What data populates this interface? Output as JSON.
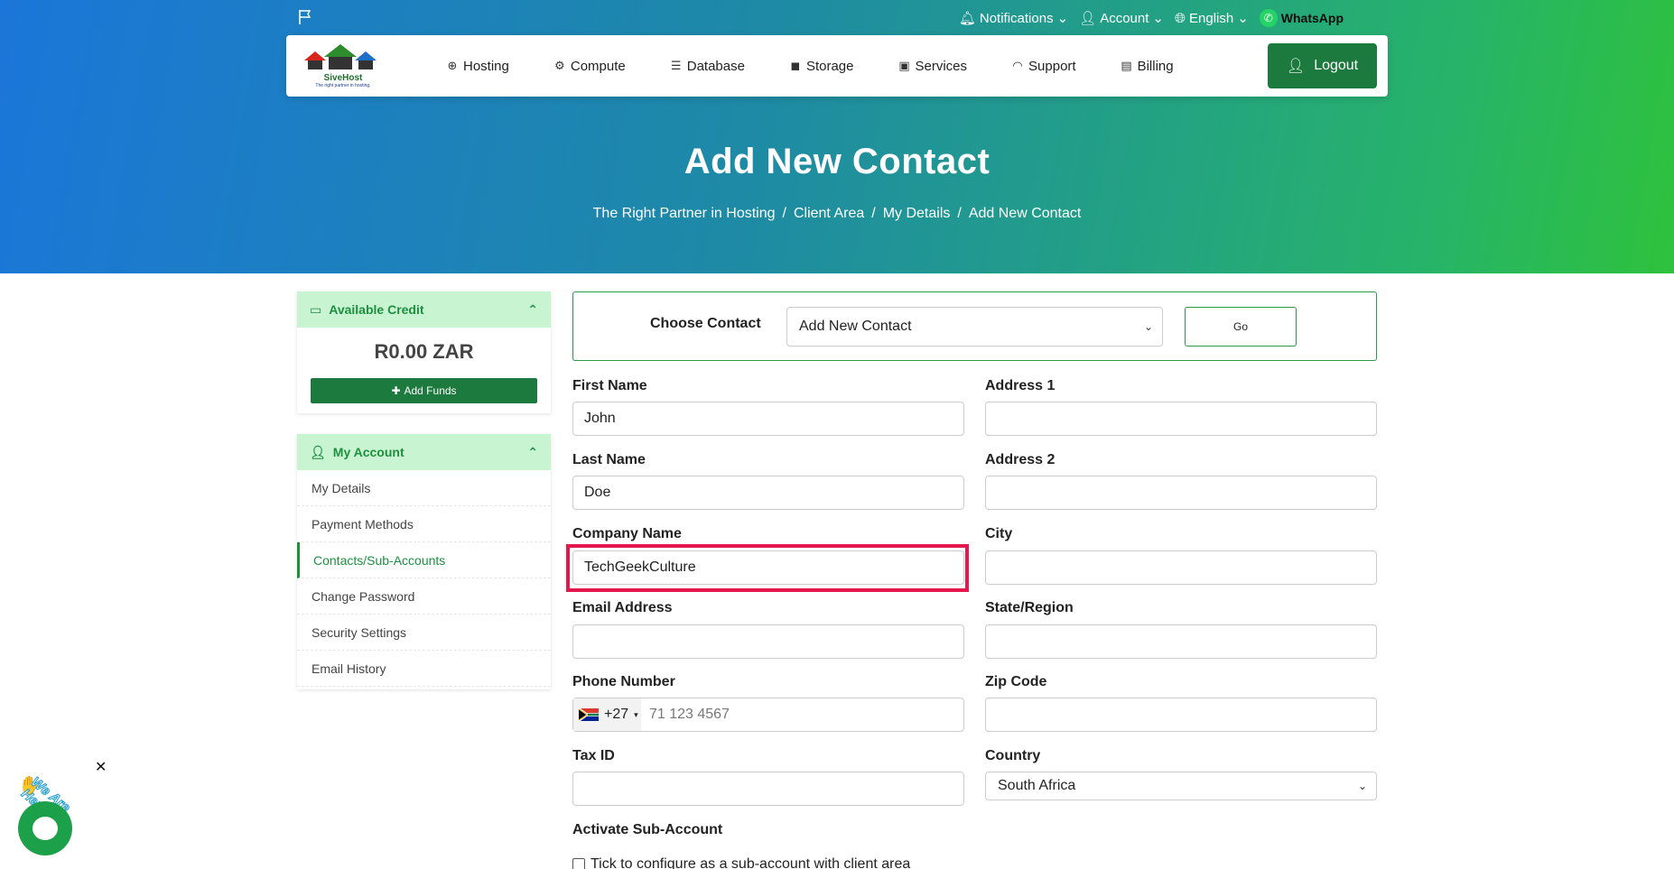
{
  "topbar": {
    "notifications": "Notifications",
    "account": "Account",
    "language": "English",
    "whatsapp": "WhatsApp"
  },
  "logo": {
    "name": "SiveHost",
    "tagline": "The right partner in hosting."
  },
  "nav": [
    {
      "label": "Hosting",
      "icon": "globe-icon"
    },
    {
      "label": "Compute",
      "icon": "gear-icon"
    },
    {
      "label": "Database",
      "icon": "database-icon"
    },
    {
      "label": "Storage",
      "icon": "box-icon"
    },
    {
      "label": "Services",
      "icon": "gift-icon"
    },
    {
      "label": "Support",
      "icon": "headset-icon"
    },
    {
      "label": "Billing",
      "icon": "invoice-icon"
    }
  ],
  "logout_label": "Logout",
  "hero": {
    "title": "Add New Contact",
    "breadcrumb": [
      "The Right Partner in Hosting",
      "Client Area",
      "My Details",
      "Add New Contact"
    ]
  },
  "sidebar": {
    "credit_title": "Available Credit",
    "credit_amount": "R0.00 ZAR",
    "add_funds": "Add Funds",
    "account_title": "My Account",
    "items": [
      "My Details",
      "Payment Methods",
      "Contacts/Sub-Accounts",
      "Change Password",
      "Security Settings",
      "Email History"
    ],
    "active_item": "Contacts/Sub-Accounts"
  },
  "form": {
    "choose_contact_label": "Choose Contact",
    "choose_contact_value": "Add New Contact",
    "go_label": "Go",
    "first_name_label": "First Name",
    "first_name_value": "John",
    "last_name_label": "Last Name",
    "last_name_value": "Doe",
    "company_label": "Company Name",
    "company_value": "TechGeekCulture",
    "email_label": "Email Address",
    "email_value": "",
    "phone_label": "Phone Number",
    "phone_code": "+27",
    "phone_placeholder": "71 123 4567",
    "tax_label": "Tax ID",
    "tax_value": "",
    "address1_label": "Address 1",
    "address2_label": "Address 2",
    "city_label": "City",
    "state_label": "State/Region",
    "zip_label": "Zip Code",
    "country_label": "Country",
    "country_value": "South Africa",
    "activate_label": "Activate Sub-Account",
    "checkbox_label": "Tick to configure as a sub-account with client area"
  },
  "chat_widget": {
    "text": "We Are Here!"
  },
  "colors": {
    "brand_green": "#1d7a3e",
    "highlight": "#e5184e",
    "light_green": "#c9f4d2"
  }
}
